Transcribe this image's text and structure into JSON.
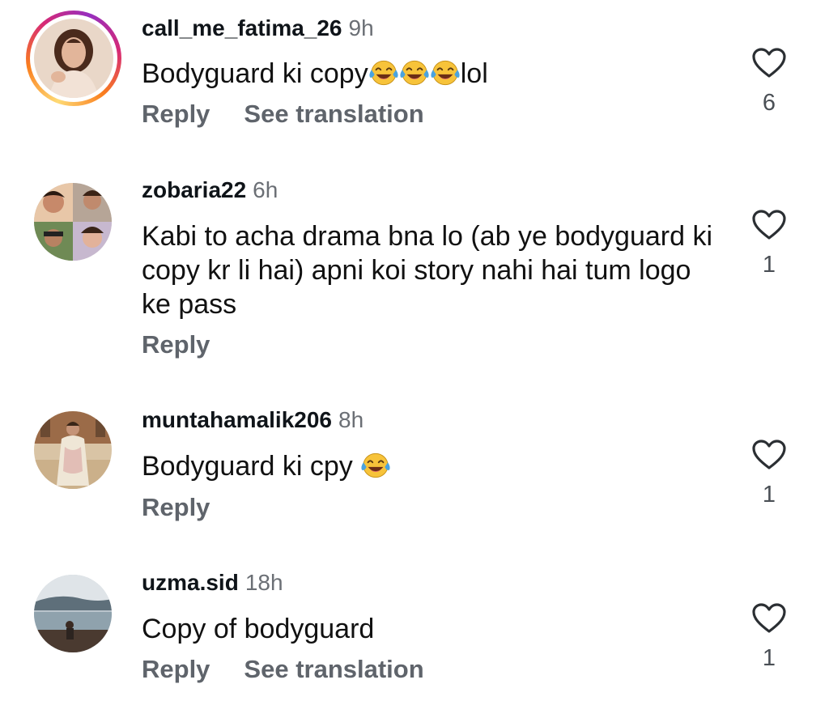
{
  "comments": [
    {
      "username": "call_me_fatima_26",
      "time": "9h",
      "text_before": "Bodyguard ki copy",
      "emojis": [
        "face-with-tears-of-joy",
        "face-with-tears-of-joy",
        "face-with-tears-of-joy"
      ],
      "text_after": "lol",
      "reply_label": "Reply",
      "translate_label": "See translation",
      "likes": "6",
      "has_story_ring": true
    },
    {
      "username": "zobaria22",
      "time": "6h",
      "text": "Kabi to acha drama bna lo (ab ye bodyguard ki copy kr li hai) apni koi story nahi hai tum logo ke pass",
      "reply_label": "Reply",
      "likes": "1"
    },
    {
      "username": "muntahamalik206",
      "time": "8h",
      "text_before": "Bodyguard ki cpy ",
      "emojis": [
        "face-with-tears-of-joy"
      ],
      "reply_label": "Reply",
      "likes": "1"
    },
    {
      "username": "uzma.sid",
      "time": "18h",
      "text": "Copy of bodyguard",
      "reply_label": "Reply",
      "translate_label": "See translation",
      "likes": "1"
    }
  ],
  "icons": {
    "like": "heart-outline-icon",
    "emoji": "face-with-tears-of-joy"
  },
  "colors": {
    "username": "#0f1419",
    "secondary_text": "#6b6f75",
    "action_text": "#5f646b",
    "story_ring": [
      "#feda75",
      "#fa7e1e",
      "#d62976",
      "#962fbf"
    ],
    "emoji_yellow": "#f7c33a",
    "emoji_tears": "#4aa3df"
  }
}
